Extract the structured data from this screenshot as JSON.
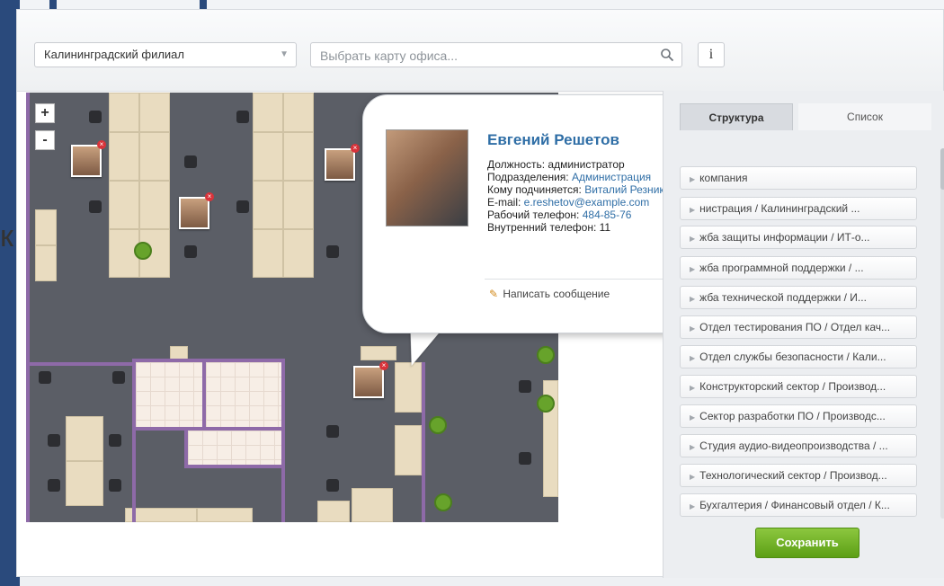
{
  "background": {
    "partial_letter": "к"
  },
  "toolbar": {
    "branch_select_value": "Калининградский филиал",
    "office_search_placeholder": "Выбрать карту офиса...",
    "info_label": "i"
  },
  "map": {
    "zoom_in": "+",
    "zoom_out": "-",
    "avatars": [
      "employee-avatar",
      "employee-avatar",
      "employee-avatar",
      "employee-avatar"
    ]
  },
  "popup": {
    "name": "Евгений Решетов",
    "position_label": "Должность: ",
    "position_value": "администратор",
    "department_label": "Подразделения: ",
    "department_value": "Администрация",
    "manager_label": "Кому подчиняется: ",
    "manager_value": "Виталий Резников",
    "email_label": "E-mail: ",
    "email_value": "e.reshetov@example.com",
    "work_phone_label": "Рабочий телефон: ",
    "work_phone_value": "484-85-76",
    "internal_phone_label": "Внутренний телефон: ",
    "internal_phone_value": "11",
    "write_message": "Написать сообщение"
  },
  "panel": {
    "tabs": [
      {
        "label": "Структура"
      },
      {
        "label": "Список"
      }
    ],
    "departments": [
      "компания",
      "нистрация / Калининградский ...",
      "жба защиты информации / ИТ-о...",
      "жба программной поддержки / ...",
      "жба технической поддержки / И...",
      "Отдел тестирования ПО / Отдел кач...",
      "Отдел службы безопасности / Кали...",
      "Конструкторский сектор / Производ...",
      "Сектор разработки ПО / Производс...",
      "Студия аудио-видеопроизводства / ...",
      "Технологический сектор / Производ...",
      "Бухгалтерия / Финансовый отдел / К..."
    ],
    "save_label": "Сохранить"
  },
  "colors": {
    "accent_link": "#2f6ea6",
    "save_green": "#6eb22a",
    "map_floor": "#5b5e66",
    "wall_purple": "#8e6aa8"
  }
}
